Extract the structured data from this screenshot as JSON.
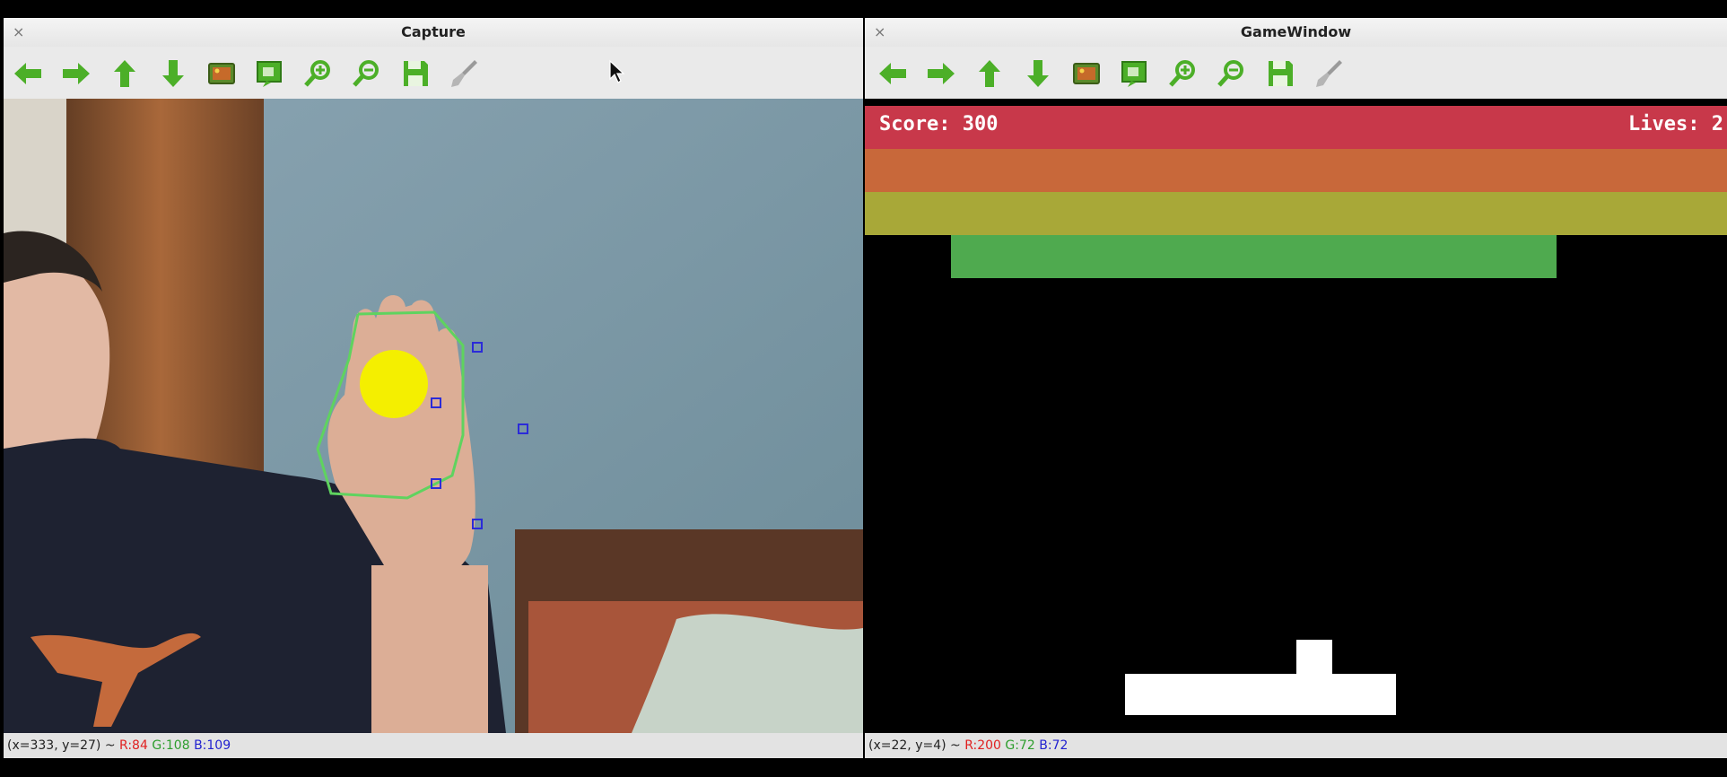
{
  "capture_window": {
    "title": "Capture",
    "close_glyph": "×",
    "status": {
      "coords": "(x=333, y=27) ~",
      "r": "R:84",
      "g": "G:108",
      "b": "B:109"
    }
  },
  "game_window": {
    "title": "GameWindow",
    "close_glyph": "×",
    "score": "Score: 300",
    "lives": "Lives: 2",
    "brick_colors": [
      "#c8384a",
      "#c8683a",
      "#a8a838",
      "#4faa4f"
    ],
    "status": {
      "coords": "(x=22, y=4) ~",
      "r": "R:200",
      "g": "G:72",
      "b": "B:72"
    }
  },
  "toolbar_icons": [
    "arrow-left-icon",
    "arrow-right-icon",
    "arrow-up-icon",
    "arrow-down-icon",
    "image-icon",
    "zoom-region-icon",
    "zoom-in-icon",
    "zoom-out-icon",
    "save-icon",
    "brush-icon"
  ],
  "colors": {
    "toolbar_green": "#4caf28",
    "tracking_dot": "#f4ef00",
    "hand_contour": "#5fd35f",
    "markers": "#2b2bd8"
  }
}
